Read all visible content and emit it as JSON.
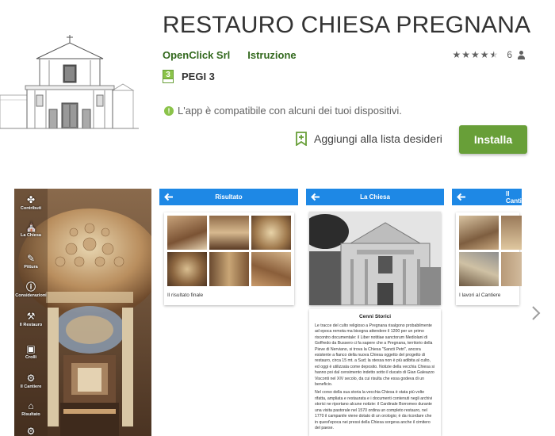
{
  "app": {
    "title": "RESTAURO CHIESA PREGNANA",
    "developer": "OpenClick Srl",
    "category": "Istruzione",
    "rating_count": "6",
    "rating_value": 4.5,
    "pegi_badge": "3",
    "pegi_label": "PEGI 3",
    "compatibility": "L'app è compatibile con alcuni dei tuoi dispositivi.",
    "wishlist_label": "Aggiungi alla lista desideri",
    "install_label": "Installa"
  },
  "colors": {
    "accent_green": "#689f38",
    "developer_green": "#33691e",
    "app_bar_blue": "#1e88e5"
  },
  "screenshots": {
    "shot1": {
      "menu": [
        {
          "label": "Contributi",
          "icon": "fan-icon"
        },
        {
          "label": "La Chiesa",
          "icon": "church-icon"
        },
        {
          "label": "Pittura",
          "icon": "brush-icon"
        },
        {
          "label": "Considerazioni",
          "icon": "info-icon"
        },
        {
          "label": "Il Restauro",
          "icon": "tools-icon"
        },
        {
          "label": "Crolli",
          "icon": "frame-icon"
        },
        {
          "label": "Il Cantiere",
          "icon": "crane-icon"
        },
        {
          "label": "Risultato",
          "icon": "home-icon"
        }
      ]
    },
    "shot2": {
      "bar_title": "Risultato",
      "caption": "Il risultato finale"
    },
    "shot3": {
      "bar_title": "La Chiesa",
      "heading": "Cenni Storici",
      "paragraph1": "Le tracce del culto religioso a Pregnana risalgono probabilmente ad epoca remota ma bisogna attendere il 1200 per un primo riscontro documentale: il Liber notitiae sanctorum Mediolani di Goffredo da Bussero ci fa sapere che a Pregnana, territorio della Pieve di Nerviano, si trova la Chiesa \"Sancti Petri\", ancora esistente a fianco della nuova Chiesa oggetto del progetto di restauro, circa 15 mt. a Sud; la stessa non è più adibita al culto, ed oggi è utilizzata come deposito. Notizie della vecchia Chiesa si hanno poi dal censimento indetto sotto il ducato di Gian Galeazzo Visconti nel XIV secolo, da cui risulta che essa godeva di un beneficio.",
      "paragraph2": "Nel corso della sua storia la vecchia Chiesa è stata più volte rifatta, ampliata e restaurata e i documenti contenuti negli archivi storici ne riportano alcune notizie: il Cardinale Borromeo durante una visita pastorale nel 1570 ordina un completo restauro, nel 1770 il campanile viene dotato di un orologio; è da ricordare che in quest'epoca nei pressi della Chiesa sorgeva anche il cimitero del paese."
    },
    "shot4": {
      "bar_title": "Il Cantiere",
      "caption": "I lavori al Cantiere"
    }
  }
}
